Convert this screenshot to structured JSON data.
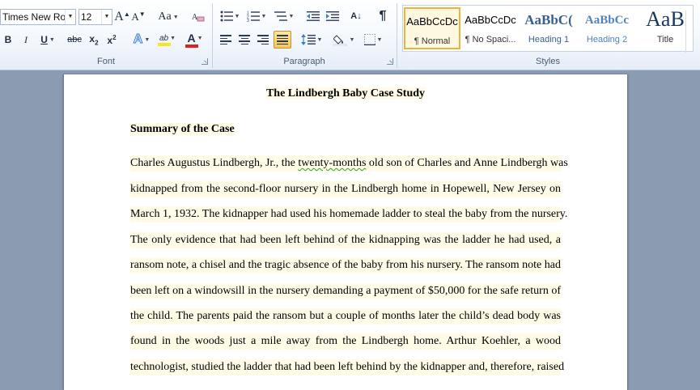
{
  "font_group": {
    "font_name": "Times New Rom",
    "font_size": "12",
    "label": "Font",
    "grow_label": "A",
    "shrink_label": "A",
    "change_case_label": "Aa",
    "bold_label": "B",
    "italic_label": "I",
    "underline_label": "U",
    "strike_label": "abc",
    "subscript_label": "x",
    "subscript_mark": "2",
    "superscript_label": "x",
    "superscript_mark": "2",
    "text_effects_label": "A",
    "highlight_label": "ab",
    "font_color_label": "A",
    "highlight_color": "#f9e51b",
    "font_color": "#e02020"
  },
  "paragraph_group": {
    "label": "Paragraph",
    "pilcrow": "¶",
    "sort_label": "A↓"
  },
  "styles_group": {
    "label": "Styles",
    "tiles": [
      {
        "sample": "AaBbCcDc",
        "name": "¶ Normal"
      },
      {
        "sample": "AaBbCcDc",
        "name": "¶ No Spaci..."
      },
      {
        "sample": "AaBbC(",
        "name": "Heading 1"
      },
      {
        "sample": "AaBbCc",
        "name": "Heading 2"
      },
      {
        "sample": "AaB",
        "name": "Title"
      }
    ],
    "heading_color": "#365f91"
  },
  "document": {
    "title": "The Lindbergh Baby Case Study",
    "section_heading": "Summary of the Case",
    "first_line": {
      "before": "Charles Augustus Lindbergh, Jr., the ",
      "flagged": "twenty-months",
      "after": " old son of Charles and Anne Lindbergh was"
    },
    "lines": [
      "kidnapped from the second-floor nursery in the Lindbergh home in Hopewell, New Jersey on",
      "March 1, 1932. The kidnapper had used his homemade ladder to steal the baby from the nursery.",
      "The only evidence that had been left behind of the kidnapping was the ladder he had used, a",
      "ransom note, a chisel and the tragic absence of the baby from his nursery. The ransom note had",
      "been left on a windowsill in the nursery demanding a payment of $50,000 for the safe return of",
      "the child. The parents paid the ransom but a couple of months later the child’s dead body was",
      "found in the woods just a mile away from the Lindbergh home. Arthur Koehler, a wood",
      "technologist, studied the ladder that had been left behind by the kidnapper and, therefore, raised"
    ]
  }
}
